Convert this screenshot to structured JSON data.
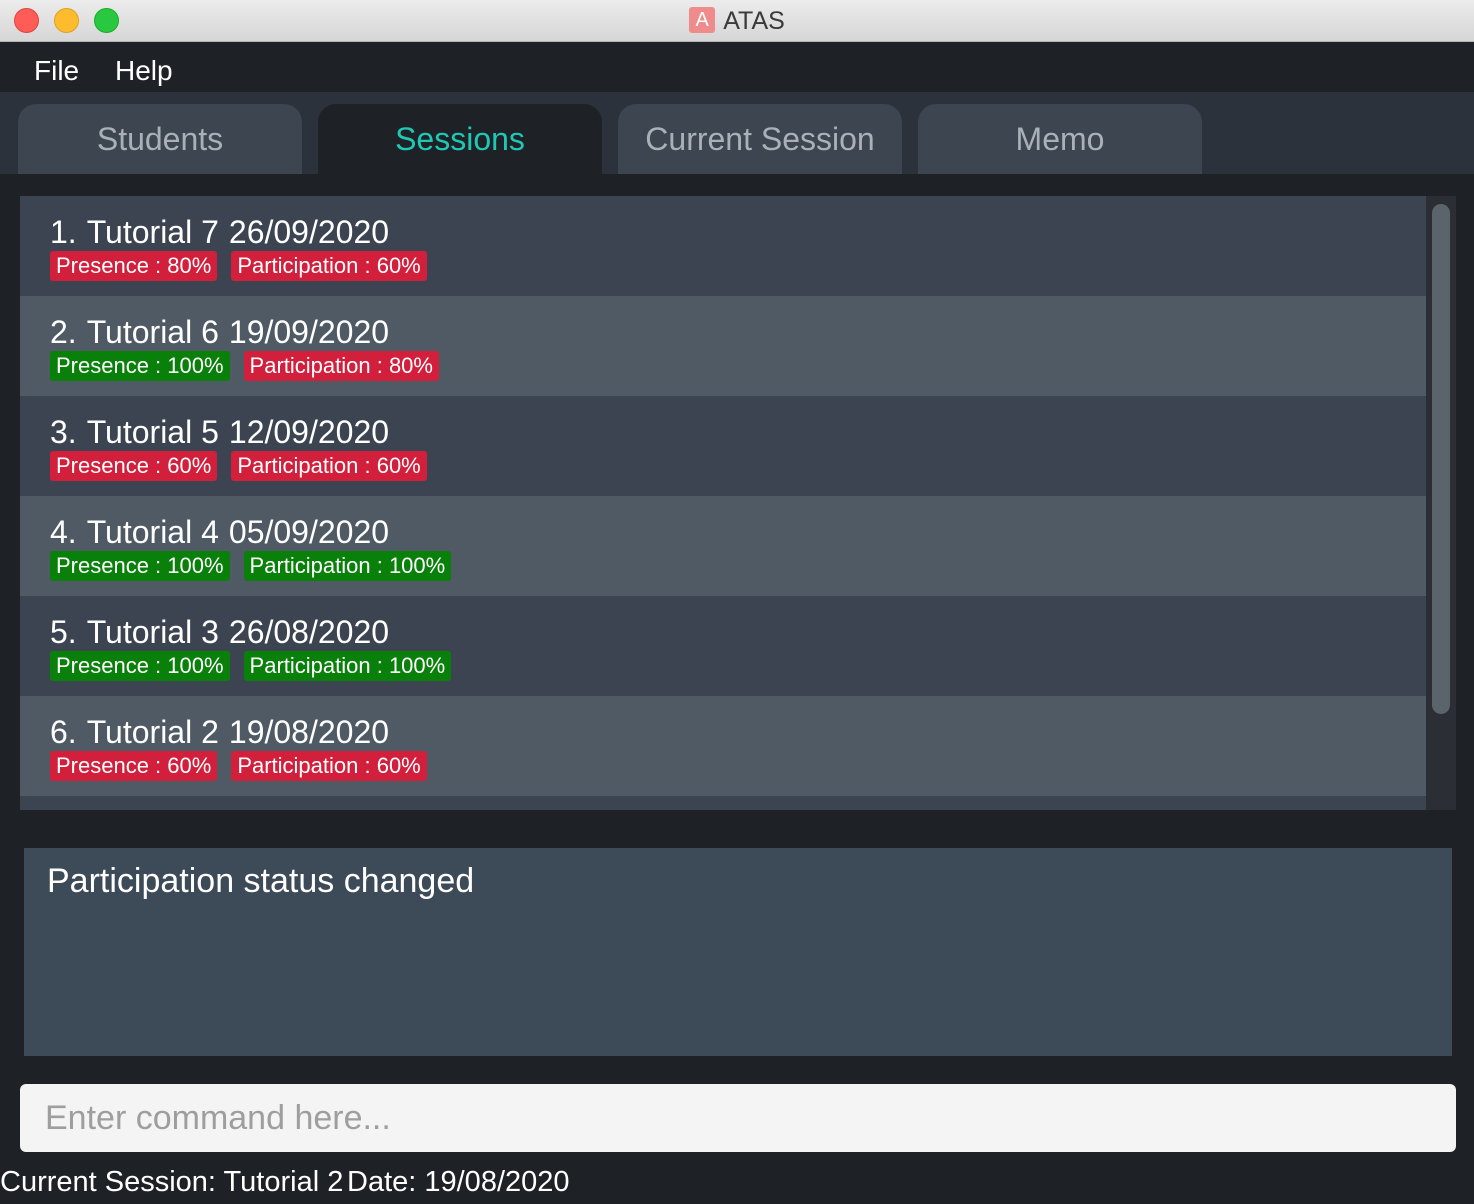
{
  "window": {
    "title": "ATAS",
    "app_icon_letter": "A"
  },
  "menu": {
    "file": "File",
    "help": "Help"
  },
  "tabs": [
    {
      "label": "Students",
      "active": false
    },
    {
      "label": "Sessions",
      "active": true
    },
    {
      "label": "Current Session",
      "active": false
    },
    {
      "label": "Memo",
      "active": false
    }
  ],
  "sessions": [
    {
      "index": "1.",
      "name": "Tutorial 7",
      "date": "26/09/2020",
      "presence": "Presence : 80%",
      "presence_status": "red",
      "participation": "Participation : 60%",
      "participation_status": "red"
    },
    {
      "index": "2.",
      "name": "Tutorial 6",
      "date": "19/09/2020",
      "presence": "Presence : 100%",
      "presence_status": "green",
      "participation": "Participation : 80%",
      "participation_status": "red"
    },
    {
      "index": "3.",
      "name": "Tutorial 5",
      "date": "12/09/2020",
      "presence": "Presence : 60%",
      "presence_status": "red",
      "participation": "Participation : 60%",
      "participation_status": "red"
    },
    {
      "index": "4.",
      "name": "Tutorial 4",
      "date": "05/09/2020",
      "presence": "Presence : 100%",
      "presence_status": "green",
      "participation": "Participation : 100%",
      "participation_status": "green"
    },
    {
      "index": "5.",
      "name": "Tutorial 3",
      "date": "26/08/2020",
      "presence": "Presence : 100%",
      "presence_status": "green",
      "participation": "Participation : 100%",
      "participation_status": "green"
    },
    {
      "index": "6.",
      "name": "Tutorial 2",
      "date": "19/08/2020",
      "presence": "Presence : 60%",
      "presence_status": "red",
      "participation": "Participation : 60%",
      "participation_status": "red"
    }
  ],
  "result": {
    "message": "Participation status changed"
  },
  "command": {
    "placeholder": "Enter command here..."
  },
  "status": {
    "current_session": "Current Session: Tutorial 2",
    "date": "Date: 19/08/2020"
  },
  "colors": {
    "accent": "#1fc8b5",
    "status_red": "#d21f3c",
    "status_green": "#09800a"
  }
}
